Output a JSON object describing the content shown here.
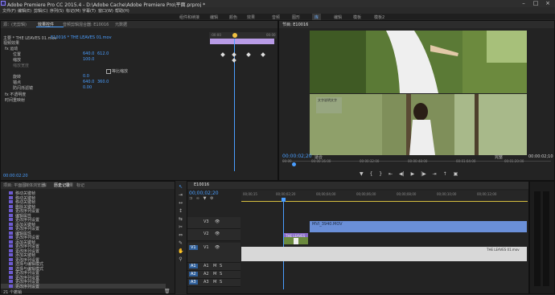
{
  "app_title": "Adobe Premiere Pro CC 2015.4 - D:\\Adobe Cache\\Adobe Premiere Pro\\平面.prproj *",
  "menu": [
    "文件(F)",
    "编辑(E)",
    "剪辑(C)",
    "序列(S)",
    "标记(M)",
    "字幕(T)",
    "窗口(W)",
    "帮助(H)"
  ],
  "workspaces": [
    "组件和续接",
    "编辑",
    "颜色",
    "效果",
    "音频",
    "图形",
    "库",
    "编辑",
    "模板",
    "模板2"
  ],
  "effect_controls": {
    "tabs": [
      "源：(无剪辑)",
      "效果控件",
      "音频剪辑混合器: E10016",
      "元数据"
    ],
    "source_clip": "主要 * THE LEAVES 01.mov",
    "target": "E10016 * THE LEAVES 01.mov",
    "ruler_times": [
      ":00:00",
      "00:00"
    ],
    "section_video": "视频效果",
    "motion": "fx 运动",
    "props": [
      {
        "name": "位置",
        "v1": "640.0",
        "v2": "612.0"
      },
      {
        "name": "缩放",
        "v1": "100.0",
        "v2": ""
      },
      {
        "name": "缩放宽度",
        "v1": "",
        "v2": ""
      },
      {
        "name": "等比缩放",
        "v1": "",
        "v2": ""
      },
      {
        "name": "旋转",
        "v1": "0.0",
        "v2": ""
      },
      {
        "name": "锚点",
        "v1": "640.0",
        "v2": "360.0"
      },
      {
        "name": "防闪烁滤镜",
        "v1": "0.00",
        "v2": ""
      }
    ],
    "opacity": "fx 不透明度",
    "time_remap": "时间重映射",
    "timecode": "00:00:02:20"
  },
  "program_monitor": {
    "tab": "节目: E10016",
    "timecode": "00:00:02;20",
    "fit": "适合",
    "full": "完整",
    "duration": "00:00:02;10",
    "ruler": [
      "00:00",
      "00:00:16:00",
      "00:00:32:00",
      "00:00:48:00",
      "00:01:04:00",
      "00:01:20:00"
    ],
    "overlay_text": "文字说明文字"
  },
  "history": {
    "tabs": [
      "项目: 平面图",
      "媒体浏览器",
      "库",
      "信息",
      "效果",
      "标记",
      "历史记录"
    ],
    "items": [
      "移动关键帧",
      "移动关键帧",
      "移动关键帧",
      "删除关键帧",
      "更改序列设置",
      "编辑属性",
      "更改序列设置",
      "添加关键帧",
      "更改序列设置",
      "编辑属性",
      "更改序列设置",
      "添加关键帧",
      "更改序列设置",
      "更改序列设置",
      "添加关键帧",
      "更改序列设置",
      "选择与编辑模式",
      "选择与编辑模式",
      "更改序列设置",
      "更改序列设置",
      "更改序列设置",
      "更改序列设置"
    ],
    "status": "21 个撤销"
  },
  "timeline": {
    "tab": "E10016",
    "timecode": "00;00;02;20",
    "ruler": [
      "00;00;15",
      "00;00;02;20",
      "00;00;04;00",
      "00;00;06;00",
      "00;00;08;00",
      "00;00;10;00",
      "00;00;12;00"
    ],
    "tracks": [
      "V3",
      "V2",
      "V1",
      "A1",
      "A2",
      "A3"
    ],
    "clip_v2": "MVI_3940.MOV",
    "clip_v1": "THE LEAVES 01.mov",
    "clip_v1_small": "THE LEAVES"
  }
}
